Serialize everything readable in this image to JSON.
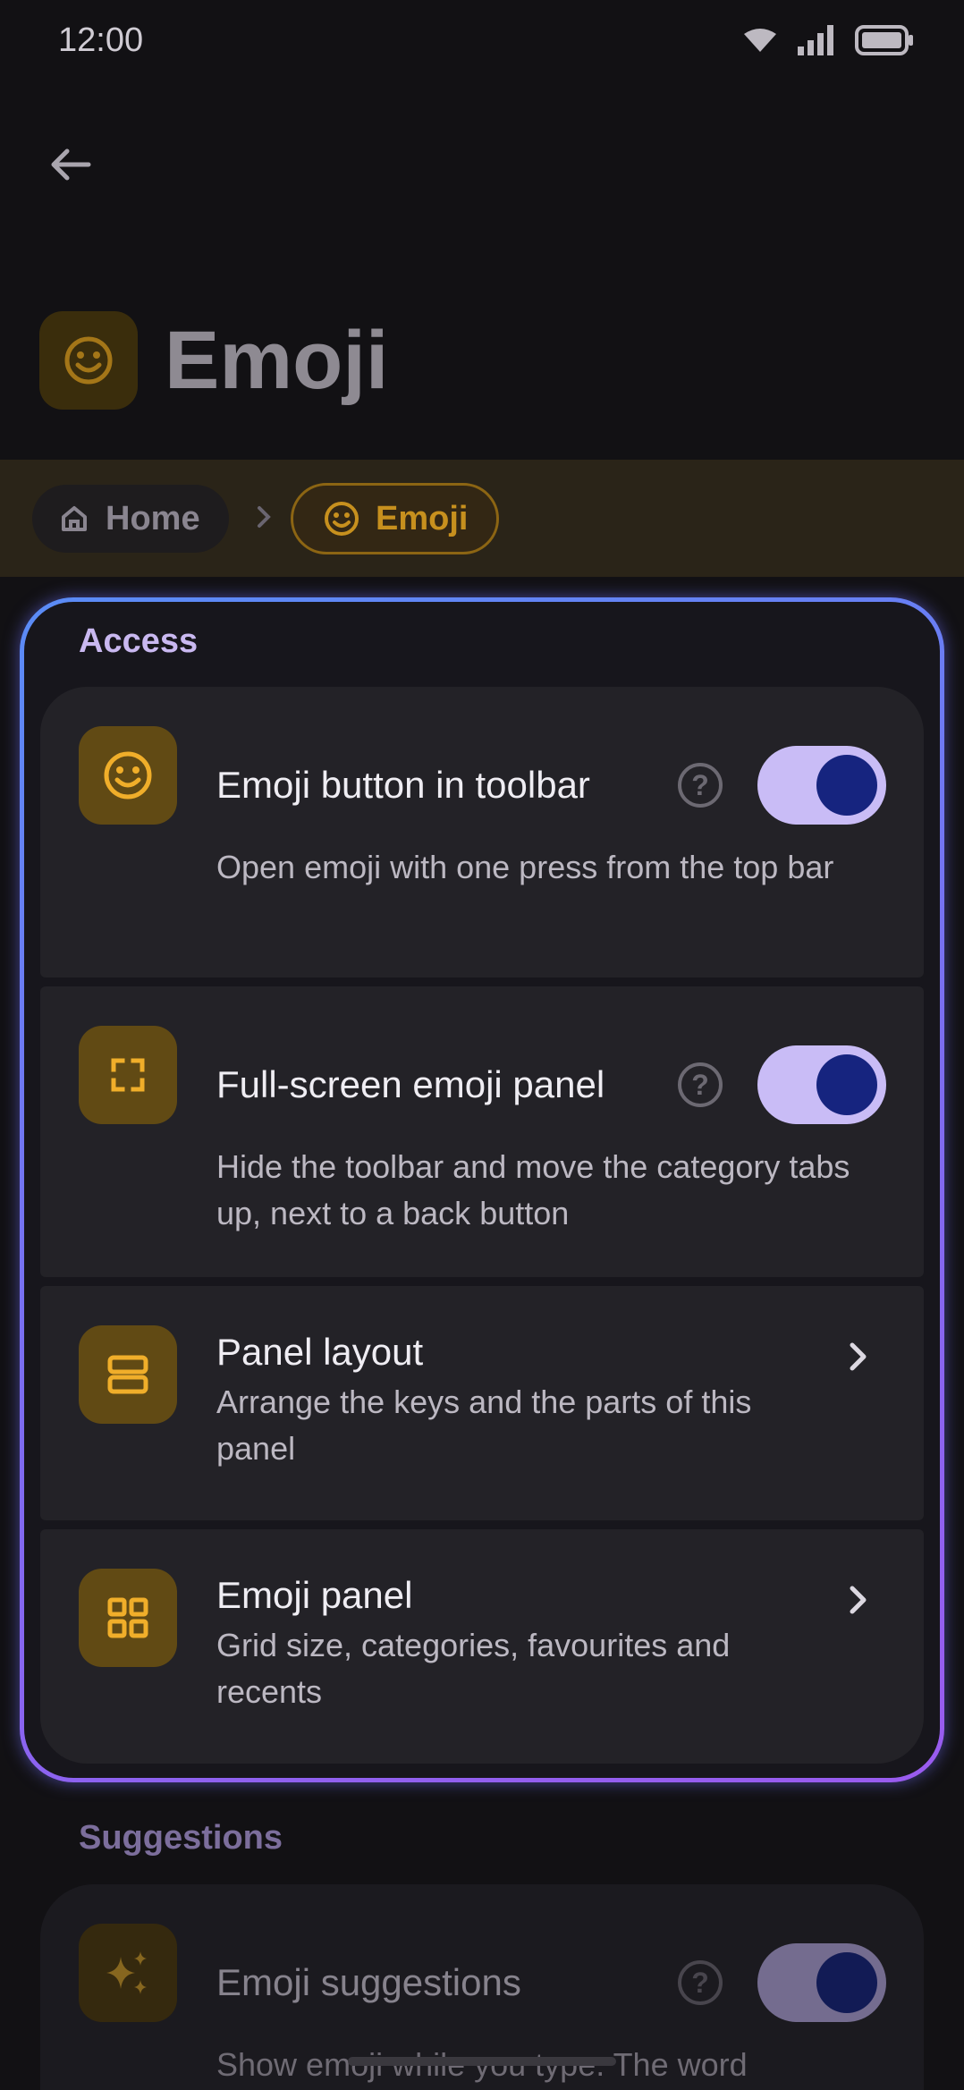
{
  "status": {
    "time": "12:00"
  },
  "header": {
    "title": "Emoji"
  },
  "breadcrumb": {
    "home": "Home",
    "current": "Emoji"
  },
  "sections": {
    "access": "Access",
    "suggestions": "Suggestions"
  },
  "items": [
    {
      "title": "Emoji button in toolbar",
      "desc": "Open emoji with one press from the top bar",
      "toggle": true
    },
    {
      "title": "Full-screen emoji panel",
      "desc": "Hide the toolbar and move the category tabs up, next to a back button",
      "toggle": true
    },
    {
      "title": "Panel layout",
      "desc": "Arrange the keys and the parts of this panel"
    },
    {
      "title": "Emoji panel",
      "desc": "Grid size, categories, favourites and recents"
    }
  ],
  "suggestion_item": {
    "title": "Emoji suggestions",
    "desc": "Show emoji while you type. The word",
    "toggle": true
  },
  "help_glyph": "?",
  "colors": {
    "accent": "#C7901E",
    "toggle_track": "#C9BCF6",
    "toggle_knob": "#16247F",
    "highlight_start": "#5A8CF6",
    "highlight_end": "#9A5BEF"
  }
}
